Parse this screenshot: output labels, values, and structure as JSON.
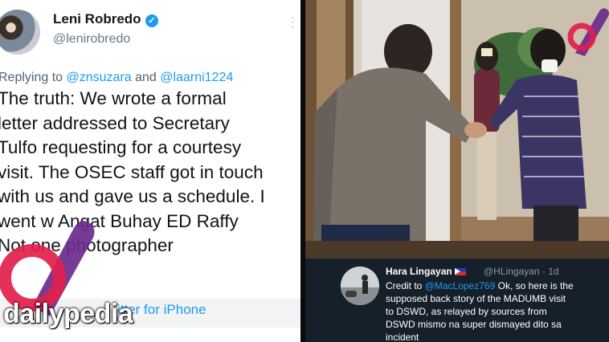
{
  "tweet": {
    "display_name": "Leni Robredo",
    "verified_icon": "verified-badge-icon",
    "handle": "@lenirobredo",
    "reply_prefix": "Replying to",
    "reply_mention_1": "@znsuzara",
    "reply_and": "and",
    "reply_mention_2": "@laarni1224",
    "lines": [
      "The truth: We wrote a formal",
      "letter addressed to Secretary",
      "Tulfo requesting for a courtesy",
      "visit. The OSEC staff got in touch",
      "with us and gave us a schedule. I",
      "went w    Angat Buhay ED Raffy",
      "                Not one photographer"
    ],
    "source": "itter for iPhone"
  },
  "watermark": {
    "brand": "dailypedia"
  },
  "overlay_tweet": {
    "name": "Hara Lingayan",
    "handle_time": "@HLingayan · 1d",
    "text_prefix": "Credit to",
    "mention": "@MacLopez769",
    "text_line1_rest": " Ok, so here is the",
    "lines": [
      "supposed back story of the MADUMB visit",
      "to DSWD, as relayed by sources from",
      "DSWD mismo na super dismayed dito sa",
      "incident"
    ]
  },
  "colors": {
    "twitter_blue": "#1d9bf0",
    "brand_red": "#e21f4c",
    "brand_purple": "#6a2a8c",
    "dark_card": "#15202b"
  }
}
